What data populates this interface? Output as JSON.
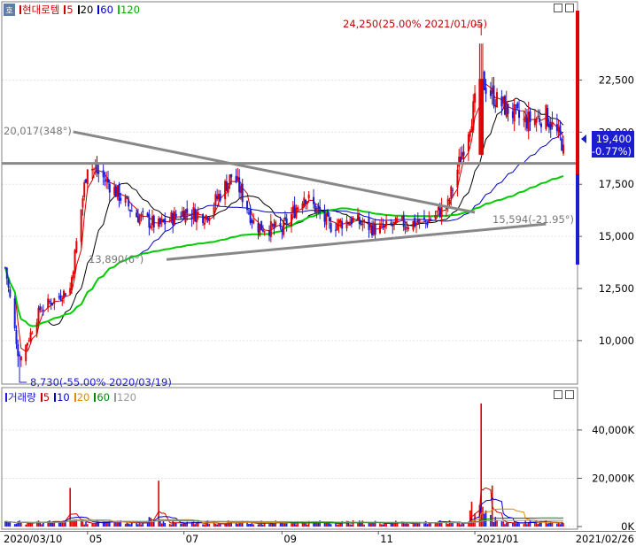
{
  "window": {
    "corner_glyph": "호"
  },
  "price": {
    "legend": {
      "title": "현대로템",
      "items": [
        {
          "label": "5",
          "color": "#cc0000"
        },
        {
          "label": "20",
          "color": "#000000"
        },
        {
          "label": "60",
          "color": "#0000cc"
        },
        {
          "label": "120",
          "color": "#00cc00"
        }
      ]
    },
    "annotations": {
      "high": "24,250(25.00% 2021/01/05)",
      "low": "8,730(-55.00% 2020/03/19)",
      "left_trend": "20,017(348°)",
      "left_low": "13,890(6°)",
      "right_trend": "15,594(-21.95°)"
    },
    "current_price": "19,400",
    "current_change": "(-0.77%)"
  },
  "volume": {
    "legend": {
      "title": "거래량",
      "items": [
        {
          "label": "5",
          "color": "#cc0000"
        },
        {
          "label": "10",
          "color": "#0000cc"
        },
        {
          "label": "20",
          "color": "#e08a00"
        },
        {
          "label": "60",
          "color": "#008800"
        },
        {
          "label": "120",
          "color": "#999999"
        }
      ]
    }
  },
  "colors": {
    "up": "#e00000",
    "down": "#1c1cd0",
    "ma5": "#cc0000",
    "ma20": "#000000",
    "ma60": "#0000cc",
    "ma120": "#00cc00",
    "trend": "#888888",
    "hline": "#888888"
  },
  "chart_data": [
    {
      "type": "candlestick",
      "title": "현대로템",
      "period": [
        "2020/03/10",
        "2021/02/26"
      ],
      "ylim": [
        8000,
        26000
      ],
      "yticks": [
        10000,
        12500,
        15000,
        17500,
        20000,
        22500
      ],
      "ytick_labels": [
        "10,000",
        "12,500",
        "15,000",
        "17,500",
        "20,000",
        "22,500"
      ],
      "xtick_labels": [
        "2020/03/10",
        "05",
        "07",
        "09",
        "11",
        "2021/01",
        "2021/02/26"
      ],
      "horizontal_line": 18500,
      "high": {
        "value": 24250,
        "date": "2021/01/05"
      },
      "low": {
        "value": 8730,
        "date": "2020/03/19"
      },
      "last_close": 19400,
      "moving_averages": [
        "5",
        "20",
        "60",
        "120"
      ],
      "close_approx": {
        "dates": [
          "2020/03/10",
          "2020/03/19",
          "2020/04/01",
          "2020/04/20",
          "2020/05/01",
          "2020/05/15",
          "2020/06/01",
          "2020/06/15",
          "2020/07/01",
          "2020/07/15",
          "2020/08/01",
          "2020/08/15",
          "2020/09/01",
          "2020/09/15",
          "2020/10/01",
          "2020/10/15",
          "2020/11/01",
          "2020/11/15",
          "2020/12/01",
          "2020/12/15",
          "2021/01/05",
          "2021/01/15",
          "2021/02/01",
          "2021/02/15",
          "2021/02/26"
        ],
        "values": [
          13500,
          9000,
          11500,
          12500,
          18500,
          17500,
          16000,
          15500,
          16200,
          16000,
          18000,
          15500,
          15300,
          17000,
          15500,
          15800,
          15300,
          15600,
          15700,
          16500,
          22500,
          21500,
          20500,
          20800,
          19400
        ]
      }
    },
    {
      "type": "bar",
      "title": "거래량",
      "ylim": [
        0,
        55000
      ],
      "yticks": [
        0,
        20000,
        40000
      ],
      "ytick_labels": [
        "0K",
        "20,000K",
        "40,000K"
      ],
      "peaks": [
        {
          "date": "2020/04/20",
          "value": 16000
        },
        {
          "date": "2020/06/15",
          "value": 19000
        },
        {
          "date": "2020/08/01",
          "value": 7000
        },
        {
          "date": "2021/01/05",
          "value": 51000
        },
        {
          "date": "2021/01/12",
          "value": 17000
        }
      ]
    }
  ]
}
